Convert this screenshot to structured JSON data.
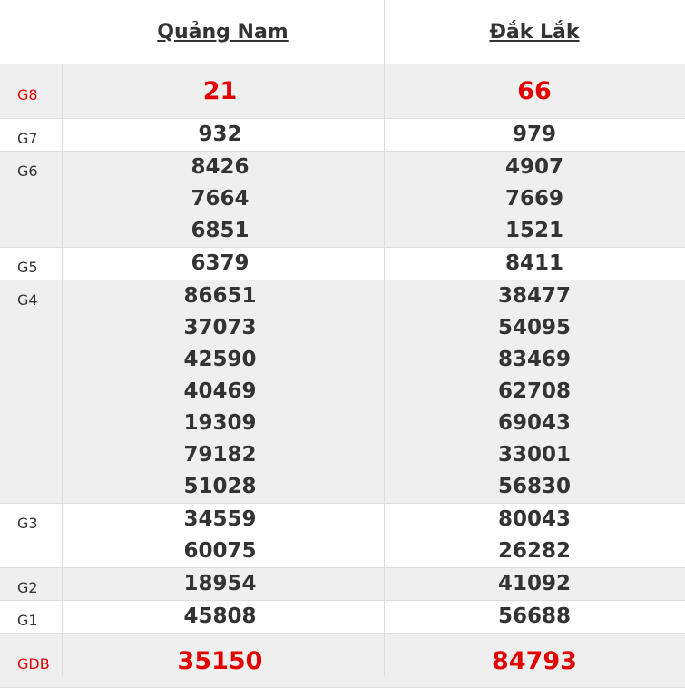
{
  "provinces": [
    "Quảng Nam",
    "Đắk Lắk"
  ],
  "rows": [
    {
      "label": "G8",
      "highlight": true,
      "values": [
        [
          "21"
        ],
        [
          "66"
        ]
      ]
    },
    {
      "label": "G7",
      "highlight": false,
      "values": [
        [
          "932"
        ],
        [
          "979"
        ]
      ]
    },
    {
      "label": "G6",
      "highlight": false,
      "values": [
        [
          "8426",
          "7664",
          "6851"
        ],
        [
          "4907",
          "7669",
          "1521"
        ]
      ]
    },
    {
      "label": "G5",
      "highlight": false,
      "values": [
        [
          "6379"
        ],
        [
          "8411"
        ]
      ]
    },
    {
      "label": "G4",
      "highlight": false,
      "values": [
        [
          "86651",
          "37073",
          "42590",
          "40469",
          "19309",
          "79182",
          "51028"
        ],
        [
          "38477",
          "54095",
          "83469",
          "62708",
          "69043",
          "33001",
          "56830"
        ]
      ]
    },
    {
      "label": "G3",
      "highlight": false,
      "values": [
        [
          "34559",
          "60075"
        ],
        [
          "80043",
          "26282"
        ]
      ]
    },
    {
      "label": "G2",
      "highlight": false,
      "values": [
        [
          "18954"
        ],
        [
          "41092"
        ]
      ]
    },
    {
      "label": "G1",
      "highlight": false,
      "values": [
        [
          "45808"
        ],
        [
          "56688"
        ]
      ]
    },
    {
      "label": "GDB",
      "highlight": true,
      "values": [
        [
          "35150"
        ],
        [
          "84793"
        ]
      ]
    }
  ],
  "colors": {
    "highlight": "#e30000",
    "text": "#333333",
    "shade": "#efefef",
    "border": "#dcdcdc"
  }
}
